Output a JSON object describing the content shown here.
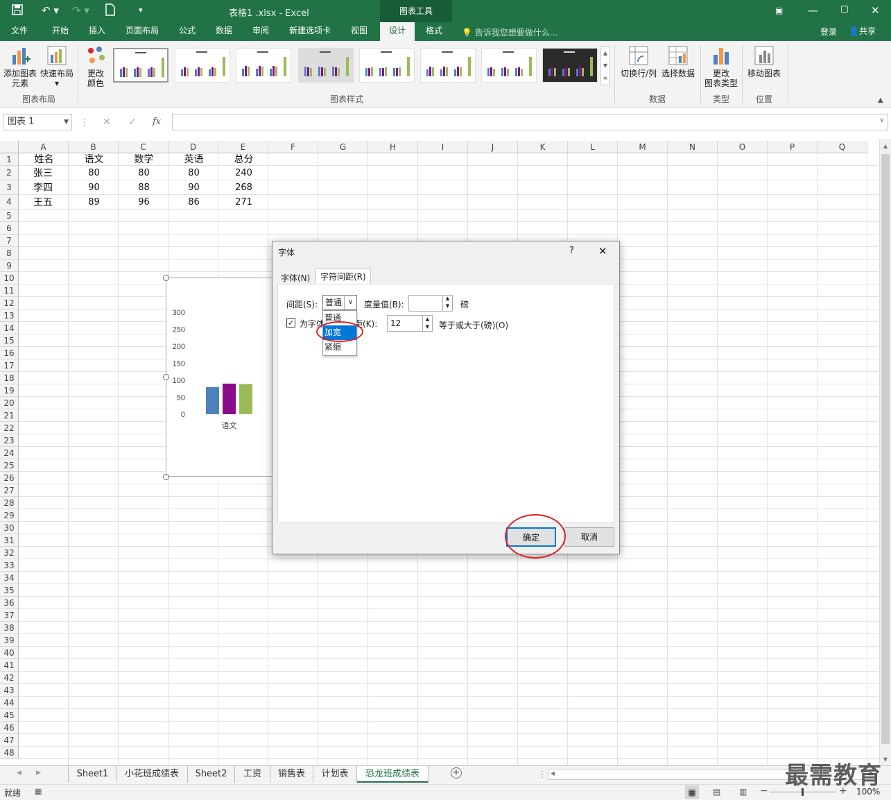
{
  "app": {
    "title": "表格1 .xlsx - Excel",
    "context_tab_title": "图表工具",
    "login": "登录",
    "share": "共享",
    "tellme": "告诉我您想要做什么..."
  },
  "ribbon_tabs": [
    "文件",
    "开始",
    "插入",
    "页面布局",
    "公式",
    "数据",
    "审阅",
    "新建选项卡",
    "视图",
    "设计",
    "格式"
  ],
  "ribbon": {
    "add_element": "添加图表",
    "add_element2": "元素",
    "quick_layout": "快速布局",
    "change_color": "更改",
    "change_color2": "颜色",
    "group_layout": "图表布局",
    "group_styles": "图表样式",
    "switch_rowcol": "切换行/列",
    "select_data": "选择数据",
    "group_data": "数据",
    "change_type": "更改",
    "change_type2": "图表类型",
    "group_type": "类型",
    "move_chart": "移动图表",
    "group_location": "位置"
  },
  "formula_bar": {
    "name_box": "图表 1",
    "fx": "fx"
  },
  "columns": [
    "A",
    "B",
    "C",
    "D",
    "E",
    "F",
    "G",
    "H",
    "I",
    "J",
    "K",
    "L",
    "M",
    "N",
    "O",
    "P",
    "Q"
  ],
  "rows": [
    "1",
    "2",
    "3",
    "4",
    "5",
    "6",
    "7",
    "8",
    "9",
    "10",
    "11",
    "12",
    "13",
    "14",
    "15",
    "16",
    "17",
    "18",
    "19",
    "20",
    "21",
    "22",
    "23",
    "24",
    "25",
    "26",
    "27",
    "28",
    "29",
    "30",
    "31",
    "32",
    "33",
    "34",
    "35",
    "36",
    "37",
    "38",
    "39",
    "40",
    "41",
    "42",
    "43",
    "44",
    "45",
    "46",
    "47",
    "48"
  ],
  "table": {
    "header": [
      "姓名",
      "语文",
      "数学",
      "英语",
      "总分"
    ],
    "rows": [
      [
        "张三",
        "80",
        "80",
        "80",
        "240"
      ],
      [
        "李四",
        "90",
        "88",
        "90",
        "268"
      ],
      [
        "王五",
        "89",
        "96",
        "86",
        "271"
      ]
    ]
  },
  "chart_data": {
    "type": "bar",
    "categories": [
      "语文"
    ],
    "series": [
      {
        "values": [
          80
        ],
        "color": "#4f81bd"
      },
      {
        "values": [
          90
        ],
        "color": "#8b0c8b"
      },
      {
        "values": [
          89
        ],
        "color": "#9bbb59"
      }
    ],
    "ytick_labels": [
      "300",
      "250",
      "200",
      "150",
      "100",
      "50",
      "0"
    ],
    "ylim": [
      0,
      300
    ],
    "xlabel": "",
    "ylabel": ""
  },
  "dialog": {
    "title": "字体",
    "help": "?",
    "close": "✕",
    "tab_font": "字体(N)",
    "tab_spacing": "字符间距(R)",
    "spacing_label": "间距(S):",
    "spacing_value": "普通",
    "by_label": "度量值(B):",
    "by_value": "",
    "unit": "磅",
    "kerning_label_a": "为字体",
    "kerning_label_b": "距(K):",
    "kerning_value": "12",
    "kerning_suffix": "等于或大于(磅)(O)",
    "dropdown_options": [
      "普通",
      "加宽",
      "紧缩"
    ],
    "dropdown_selected": "加宽",
    "ok": "确定",
    "cancel": "取消"
  },
  "sheet_tabs": [
    "Sheet1",
    "小花班成绩表",
    "Sheet2",
    "工资",
    "销售表",
    "计划表",
    "恐龙班成绩表"
  ],
  "active_sheet": "恐龙班成绩表",
  "status": {
    "ready": "就绪",
    "zoom": "100%"
  },
  "watermark": "最需教育",
  "colors": {
    "excel_green": "#217346",
    "highlight_blue": "#0078d7",
    "annotation_red": "#e0202a"
  }
}
